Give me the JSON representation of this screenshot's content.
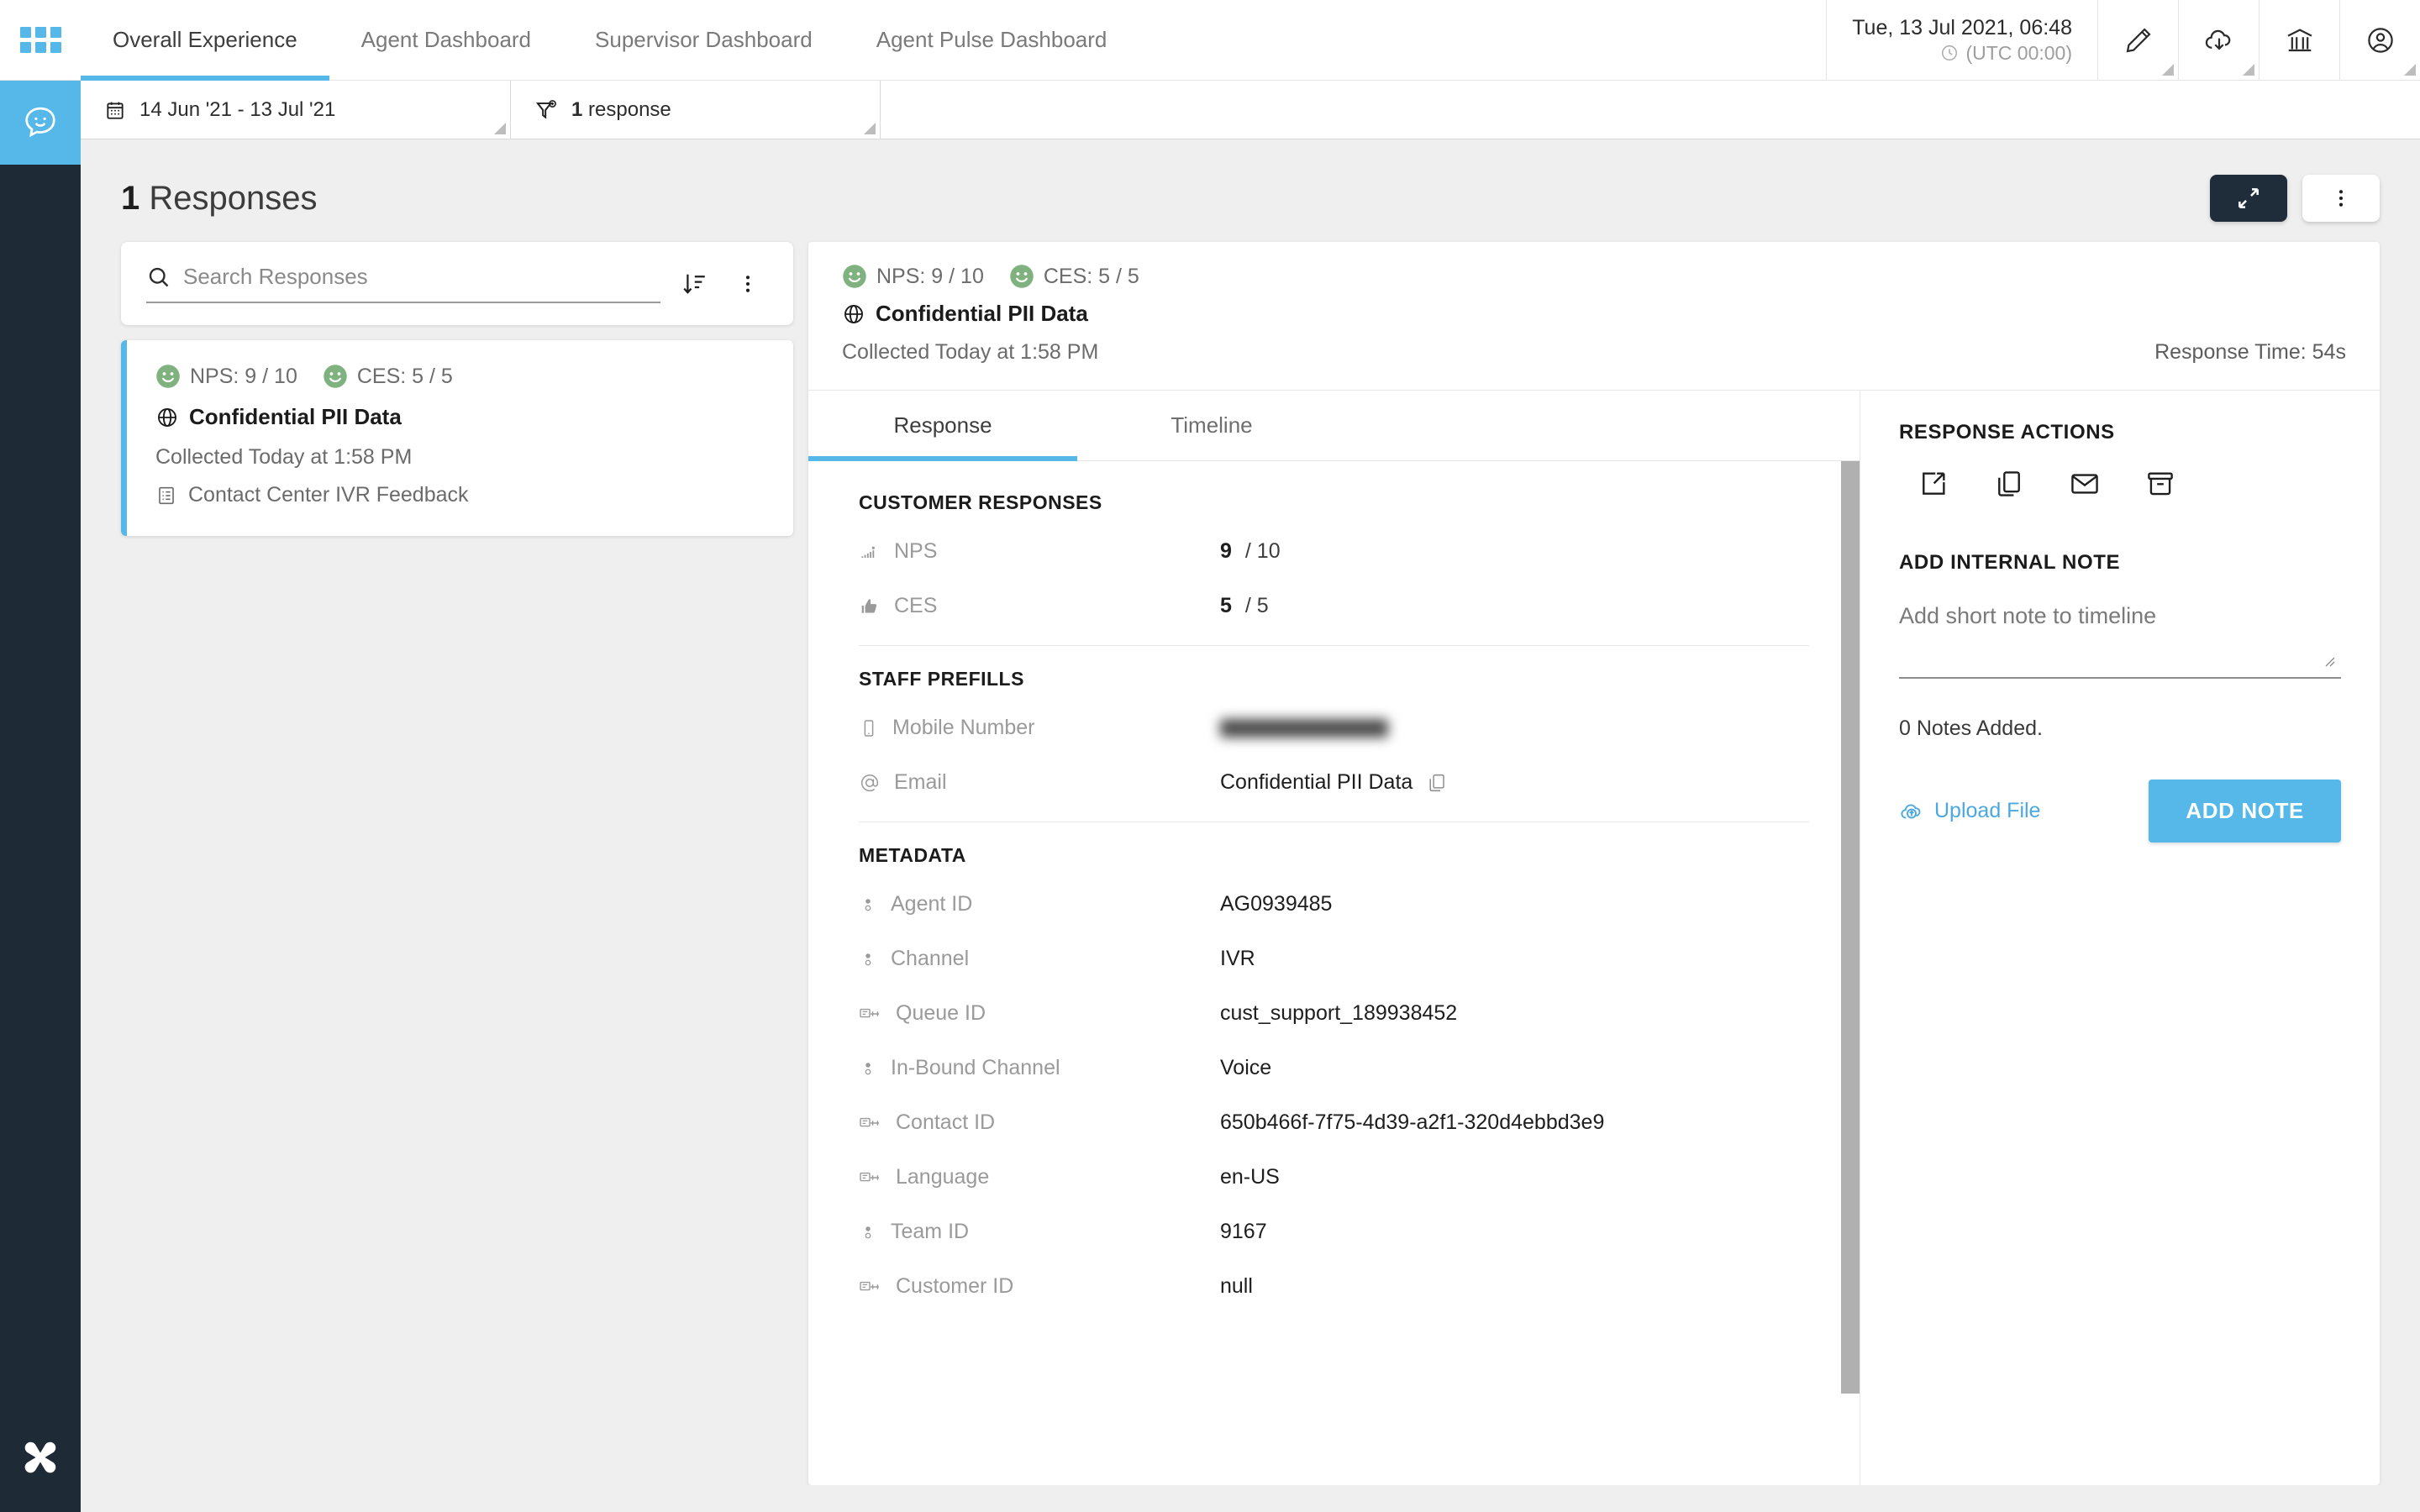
{
  "rail": {
    "apps_icon": "grid-apps-icon",
    "active_item_icon": "chat-smiley-icon",
    "logo_icon": "brand-logo-icon"
  },
  "topnav": {
    "tabs": [
      {
        "label": "Overall Experience",
        "active": true
      },
      {
        "label": "Agent Dashboard",
        "active": false
      },
      {
        "label": "Supervisor Dashboard",
        "active": false
      },
      {
        "label": "Agent Pulse Dashboard",
        "active": false
      }
    ],
    "datetime": "Tue, 13 Jul 2021, 06:48",
    "timezone": "(UTC 00:00)",
    "icons": [
      {
        "name": "pencil-edit-icon"
      },
      {
        "name": "cloud-download-icon"
      },
      {
        "name": "bank-institution-icon"
      },
      {
        "name": "user-account-icon"
      }
    ]
  },
  "filterbar": {
    "date_range": "14 Jun '21 - 13 Jul '21",
    "date_icon": "calendar-icon",
    "response_filter": "1 response",
    "response_filter_count": "1",
    "response_filter_label": "response",
    "filter_icon": "filter-add-icon"
  },
  "page": {
    "title_count": "1",
    "title_text": "Responses",
    "expand_button_icon": "expand-diagonal-icon",
    "more_button_icon": "more-vertical-icon"
  },
  "search": {
    "placeholder": "Search Responses",
    "value": "",
    "search_icon": "search-icon",
    "sort_icon": "sort-descending-icon",
    "more_icon": "more-vertical-icon"
  },
  "response_list": [
    {
      "nps_label": "NPS: 9 / 10",
      "ces_label": "CES: 5 / 5",
      "nps_icon": "smiley-happy-icon",
      "ces_icon": "smiley-happy-icon",
      "title": "Confidential PII Data",
      "title_icon": "globe-icon",
      "collected": "Collected Today at 1:58 PM",
      "form": "Contact Center IVR Feedback",
      "form_icon": "form-list-icon"
    }
  ],
  "detail": {
    "nps_label": "NPS: 9 / 10",
    "ces_label": "CES: 5 / 5",
    "title": "Confidential PII Data",
    "title_icon": "globe-icon",
    "collected": "Collected Today at 1:58 PM",
    "response_time": "Response Time: 54s",
    "tabs": [
      {
        "label": "Response",
        "active": true
      },
      {
        "label": "Timeline",
        "active": false
      }
    ],
    "sections": {
      "customer_responses": {
        "heading": "CUSTOMER RESPONSES",
        "rows": [
          {
            "label": "NPS",
            "icon": "nps-bars-icon",
            "value": "9",
            "denominator": "/ 10"
          },
          {
            "label": "CES",
            "icon": "thumbs-up-icon",
            "value": "5",
            "denominator": "/ 5"
          }
        ]
      },
      "staff_prefills": {
        "heading": "STAFF PREFILLS",
        "rows": [
          {
            "label": "Mobile Number",
            "icon": "mobile-phone-icon",
            "value": "",
            "redacted": true
          },
          {
            "label": "Email",
            "icon": "at-sign-icon",
            "value": "Confidential PII Data",
            "copy_icon": "copy-icon"
          }
        ]
      },
      "metadata": {
        "heading": "METADATA",
        "rows": [
          {
            "label": "Agent ID",
            "icon": "radio-select-icon",
            "value": "AG0939485"
          },
          {
            "label": "Channel",
            "icon": "radio-select-icon",
            "value": "IVR"
          },
          {
            "label": "Queue ID",
            "icon": "text-field-icon",
            "value": "cust_support_189938452"
          },
          {
            "label": "In-Bound Channel",
            "icon": "radio-select-icon",
            "value": "Voice"
          },
          {
            "label": "Contact ID",
            "icon": "text-field-icon",
            "value": "650b466f-7f75-4d39-a2f1-320d4ebbd3e9"
          },
          {
            "label": "Language",
            "icon": "text-field-icon",
            "value": "en-US"
          },
          {
            "label": "Team ID",
            "icon": "radio-select-icon",
            "value": "9167"
          },
          {
            "label": "Customer ID",
            "icon": "text-field-icon",
            "value": "null"
          }
        ]
      }
    }
  },
  "actions": {
    "heading": "RESPONSE ACTIONS",
    "icons": [
      {
        "name": "open-external-icon"
      },
      {
        "name": "copy-duplicate-icon"
      },
      {
        "name": "envelope-mail-icon"
      },
      {
        "name": "archive-box-icon"
      }
    ],
    "note_heading": "ADD INTERNAL NOTE",
    "note_placeholder": "Add short note to timeline",
    "note_value": "",
    "notes_count": "0 Notes Added.",
    "upload_label": "Upload File",
    "upload_icon": "cloud-upload-icon",
    "add_note_label": "ADD NOTE"
  },
  "colors": {
    "accent_blue": "#55b8e8",
    "dark_navy": "#1f2a37",
    "smiley_green": "#7fb27f",
    "page_bg": "#efefef"
  }
}
